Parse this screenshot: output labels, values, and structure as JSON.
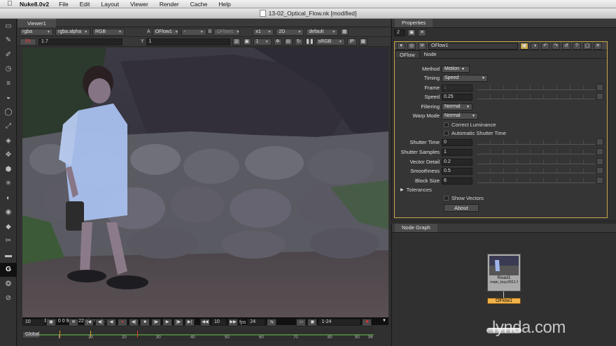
{
  "menubar": {
    "apple": "",
    "app": "Nuke8.0v2",
    "items": [
      "File",
      "Edit",
      "Layout",
      "Viewer",
      "Render",
      "Cache",
      "Help"
    ]
  },
  "window": {
    "title": "13-02_Optical_Flow.nk [modified]"
  },
  "left_tools": [
    "viewer",
    "paint",
    "draw",
    "time",
    "channel",
    "color",
    "filter",
    "keyer",
    "merge",
    "transform",
    "3d",
    "particles",
    "deep",
    "views",
    "metadata",
    "toolsets",
    "other",
    "furnace",
    "ocula",
    "nuke-logo"
  ],
  "viewer": {
    "tab": "Viewer1",
    "row1": {
      "channels": "rgba",
      "channel2": "rgba.alpha",
      "display": "RGB",
      "a_label": "A",
      "a_input": "OFlow1",
      "a_op": "-",
      "b_label": "B",
      "b_input": "OFlow1",
      "zoom": "x1",
      "mode": "2D",
      "lut": "default"
    },
    "row2": {
      "fstop": "f/8",
      "gain": "1",
      "gain_value": "1.7",
      "y_label": "Y",
      "gamma": "1",
      "frame_step": "1",
      "colorspace": "sRGB",
      "ip": "IP"
    },
    "info": "910x722 bbox: 0 0 910 722 channels:",
    "transport": {
      "frame": "10",
      "increment": "10",
      "fps_label": "fps",
      "fps": "24",
      "range": "1-24",
      "global": "Global"
    },
    "timeline_ticks": [
      "1",
      "10",
      "20",
      "30",
      "40",
      "50",
      "60",
      "70",
      "80",
      "90",
      "96"
    ]
  },
  "properties": {
    "title": "Properties",
    "max_panels": "2",
    "node_name": "OFlow1",
    "tabs": [
      "OFlow",
      "Node"
    ],
    "method": {
      "label": "Method",
      "value": "Motion"
    },
    "timing": {
      "label": "Timing",
      "value": "Speed"
    },
    "frame": {
      "label": "Frame",
      "value": "1"
    },
    "speed": {
      "label": "Speed",
      "value": "0.25"
    },
    "filtering": {
      "label": "Filtering",
      "value": "Normal"
    },
    "warp_mode": {
      "label": "Warp Mode",
      "value": "Normal"
    },
    "correct_luminance": "Correct Luminance",
    "auto_shutter": "Automatic Shutter Time",
    "shutter_time": {
      "label": "Shutter Time",
      "value": "0"
    },
    "shutter_samples": {
      "label": "Shutter Samples",
      "value": "1"
    },
    "vector_detail": {
      "label": "Vector Detail",
      "value": "0.2"
    },
    "smoothness": {
      "label": "Smoothness",
      "value": "0.5"
    },
    "block_size": {
      "label": "Block Size",
      "value": "6"
    },
    "tolerances": "Tolerances",
    "show_vectors": "Show Vectors",
    "about": "About"
  },
  "node_graph": {
    "title": "Node Graph",
    "read_node": {
      "name": "Read1",
      "file": "main_boy.0011.f"
    },
    "oflow_node": "OFlow1"
  },
  "watermark": {
    "text": "lynda",
    "suffix": ".com"
  }
}
